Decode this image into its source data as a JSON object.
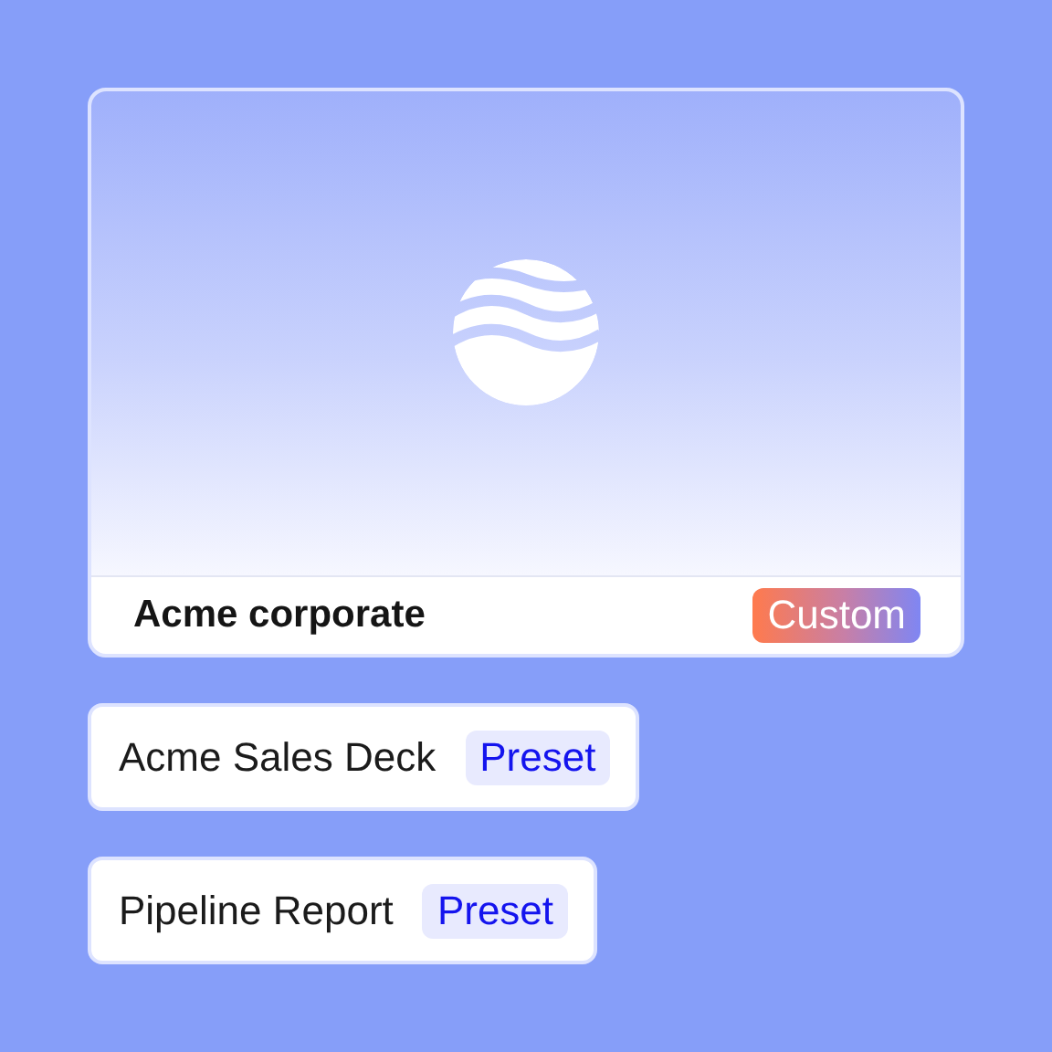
{
  "featured_template": {
    "name": "Acme corporate",
    "badge": {
      "kind": "custom",
      "label": "Custom"
    }
  },
  "templates": [
    {
      "name": "Acme Sales Deck",
      "badge": {
        "kind": "preset",
        "label": "Preset"
      }
    },
    {
      "name": "Pipeline Report",
      "badge": {
        "kind": "preset",
        "label": "Preset"
      }
    }
  ]
}
